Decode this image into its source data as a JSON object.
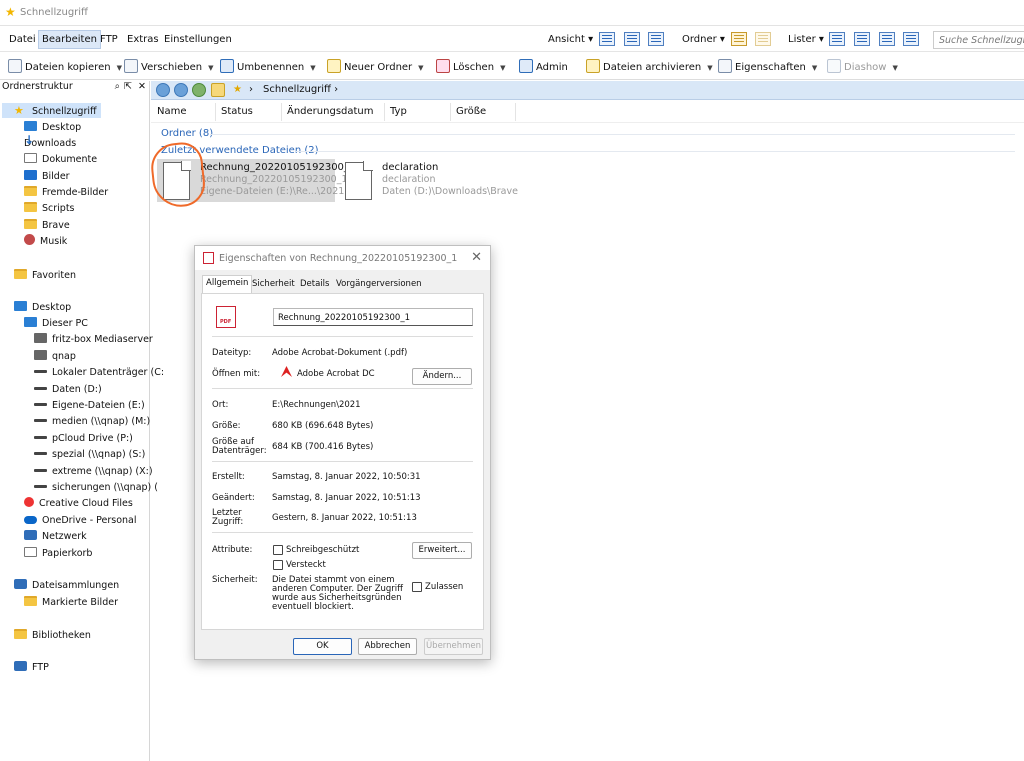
{
  "window": {
    "title": "Schnellzugriff"
  },
  "menu": {
    "items": [
      "Datei",
      "Bearbeiten",
      "FTP",
      "Extras",
      "Einstellungen"
    ],
    "ansicht": "Ansicht ▾",
    "ordner": "Ordner ▾",
    "lister": "Lister ▾",
    "search_placeholder": "Suche Schnellzugriff"
  },
  "toolbar": {
    "copy": "Dateien kopieren",
    "move": "Verschieben",
    "rename": "Umbenennen",
    "new_folder": "Neuer Ordner",
    "delete": "Löschen",
    "admin": "Admin",
    "archive": "Dateien archivieren",
    "properties": "Eigenschaften",
    "slideshow": "Diashow"
  },
  "leftpane": {
    "header": "Ordnerstruktur",
    "items": [
      {
        "label": "Schnellzugriff",
        "icon": "star-icon"
      },
      {
        "label": "Desktop",
        "icon": "desktop-icon"
      },
      {
        "label": "Downloads",
        "icon": "download-icon"
      },
      {
        "label": "Dokumente",
        "icon": "documents-icon"
      },
      {
        "label": "Bilder",
        "icon": "pictures-icon"
      },
      {
        "label": "Fremde-Bilder",
        "icon": "folder-icon"
      },
      {
        "label": "Scripts",
        "icon": "folder-icon"
      },
      {
        "label": "Brave",
        "icon": "folder-icon"
      },
      {
        "label": "Musik",
        "icon": "music-icon"
      },
      {
        "label": "Favoriten",
        "icon": "folder-icon"
      },
      {
        "label": "Desktop",
        "icon": "desktop-icon"
      },
      {
        "label": "Dieser PC",
        "icon": "pc-icon"
      },
      {
        "label": "fritz-box Mediaserver",
        "icon": "media-server-icon"
      },
      {
        "label": "qnap",
        "icon": "media-server-icon"
      },
      {
        "label": "Lokaler Datenträger (C:",
        "icon": "drive-icon"
      },
      {
        "label": "Daten (D:)",
        "icon": "drive-icon"
      },
      {
        "label": "Eigene-Dateien (E:)",
        "icon": "drive-icon"
      },
      {
        "label": "medien (\\\\qnap) (M:)",
        "icon": "network-drive-icon"
      },
      {
        "label": "pCloud Drive (P:)",
        "icon": "drive-icon"
      },
      {
        "label": "spezial (\\\\qnap) (S:)",
        "icon": "network-drive-icon"
      },
      {
        "label": "extreme (\\\\qnap) (X:)",
        "icon": "network-drive-icon"
      },
      {
        "label": "sicherungen (\\\\qnap) (",
        "icon": "network-drive-icon"
      },
      {
        "label": "Creative Cloud Files",
        "icon": "creative-cloud-icon"
      },
      {
        "label": "OneDrive - Personal",
        "icon": "onedrive-icon"
      },
      {
        "label": "Netzwerk",
        "icon": "network-icon"
      },
      {
        "label": "Papierkorb",
        "icon": "recycle-bin-icon"
      },
      {
        "label": "Dateisammlungen",
        "icon": "collections-icon"
      },
      {
        "label": "Markierte Bilder",
        "icon": "marked-pictures-icon"
      },
      {
        "label": "Bibliotheken",
        "icon": "folder-icon"
      },
      {
        "label": "FTP",
        "icon": "ftp-icon"
      }
    ]
  },
  "breadcrumb": {
    "path": "Schnellzugriff ›"
  },
  "columns": [
    "Name",
    "Status",
    "Änderungsdatum",
    "Typ",
    "Größe"
  ],
  "groups": {
    "folders": "Ordner (8)",
    "recent": "Zuletzt verwendete Dateien (2)"
  },
  "files": [
    {
      "name": "Rechnung_20220105192300_1",
      "sub": "Rechnung_20220105192300_1",
      "loc": "Eigene-Dateien (E:)\\Re...\\2021"
    },
    {
      "name": "declaration",
      "sub": "declaration",
      "loc": "Daten (D:)\\Downloads\\Brave"
    }
  ],
  "dialog": {
    "title": "Eigenschaften von Rechnung_20220105192300_1",
    "tabs": [
      "Allgemein",
      "Sicherheit",
      "Details",
      "Vorgängerversionen"
    ],
    "filename": "Rechnung_20220105192300_1",
    "labels": {
      "type": "Dateityp:",
      "opens": "Öffnen mit:",
      "location": "Ort:",
      "size": "Größe:",
      "disk1": "Größe auf",
      "disk2": "Datenträger:",
      "created": "Erstellt:",
      "modified": "Geändert:",
      "access1": "Letzter",
      "access2": "Zugriff:",
      "attributes": "Attribute:",
      "security": "Sicherheit:"
    },
    "values": {
      "type": "Adobe Acrobat-Dokument (.pdf)",
      "opens": "Adobe Acrobat DC",
      "location": "E:\\Rechnungen\\2021",
      "size": "680 KB (696.648 Bytes)",
      "disk": "684 KB (700.416 Bytes)",
      "created": "Samstag, 8. Januar 2022, 10:50:31",
      "modified": "Samstag, 8. Januar 2022, 10:51:13",
      "access": "Gestern, 8. Januar 2022, 10:51:13"
    },
    "change_btn": "Ändern...",
    "advanced_btn": "Erweitert...",
    "readonly": "Schreibgeschützt",
    "hidden": "Versteckt",
    "security_lines": [
      "Die Datei stammt von einem",
      "anderen Computer. Der Zugriff",
      "wurde aus Sicherheitsgründen",
      "eventuell blockiert."
    ],
    "allow": "Zulassen",
    "ok": "OK",
    "cancel": "Abbrechen",
    "apply": "Übernehmen"
  }
}
